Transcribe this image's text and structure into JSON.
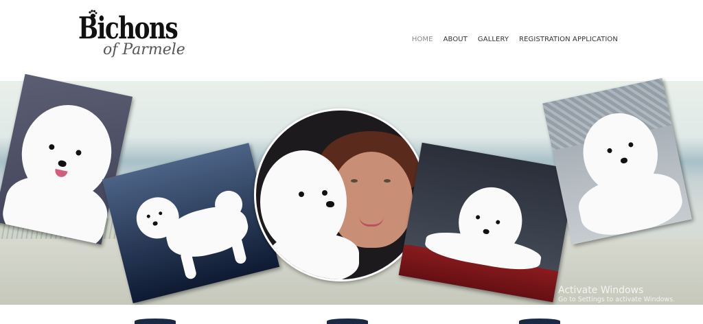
{
  "logo": {
    "main": "Bichons",
    "sub": "of Parmele"
  },
  "nav": {
    "items": [
      {
        "label": "HOME",
        "active": true
      },
      {
        "label": "ABOUT",
        "active": false
      },
      {
        "label": "GALLERY",
        "active": false
      },
      {
        "label": "REGISTRATION APPLICATION",
        "active": false
      }
    ]
  },
  "watermark": {
    "title": "Activate Windows",
    "subtitle": "Go to Settings to activate Windows."
  },
  "colors": {
    "nav_text": "#333333",
    "nav_active": "#888888",
    "background": "#ffffff"
  }
}
